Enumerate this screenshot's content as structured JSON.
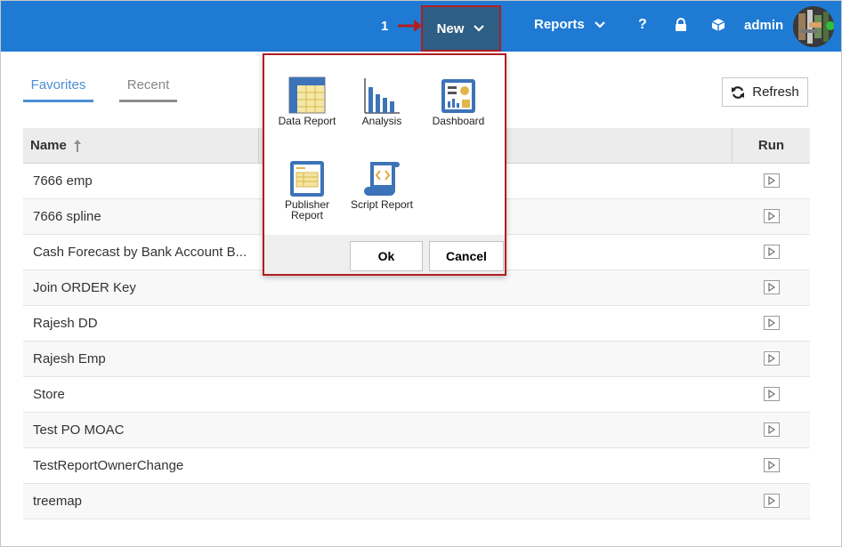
{
  "header": {
    "callout_number": "1",
    "new_label": "New",
    "reports_label": "Reports",
    "help_label": "?",
    "user_label": "admin",
    "accent_color": "#1f7ad3",
    "highlight_color": "#b01e22"
  },
  "tabs": {
    "favorites": "Favorites",
    "recent": "Recent"
  },
  "refresh_label": "Refresh",
  "table": {
    "col_name": "Name",
    "col_run": "Run",
    "rows": [
      "7666 emp",
      "7666 spline",
      "Cash Forecast by Bank Account B...",
      "Join ORDER Key",
      "Rajesh DD",
      "Rajesh Emp",
      "Store",
      "Test PO MOAC",
      "TestReportOwnerChange",
      "treemap"
    ]
  },
  "new_menu": {
    "options": [
      {
        "label": "Data Report",
        "icon": "data-report-icon"
      },
      {
        "label": "Analysis",
        "icon": "analysis-icon"
      },
      {
        "label": "Dashboard",
        "icon": "dashboard-icon"
      },
      {
        "label": "Publisher Report",
        "icon": "publisher-report-icon"
      },
      {
        "label": "Script Report",
        "icon": "script-report-icon"
      }
    ],
    "ok_label": "Ok",
    "cancel_label": "Cancel"
  }
}
